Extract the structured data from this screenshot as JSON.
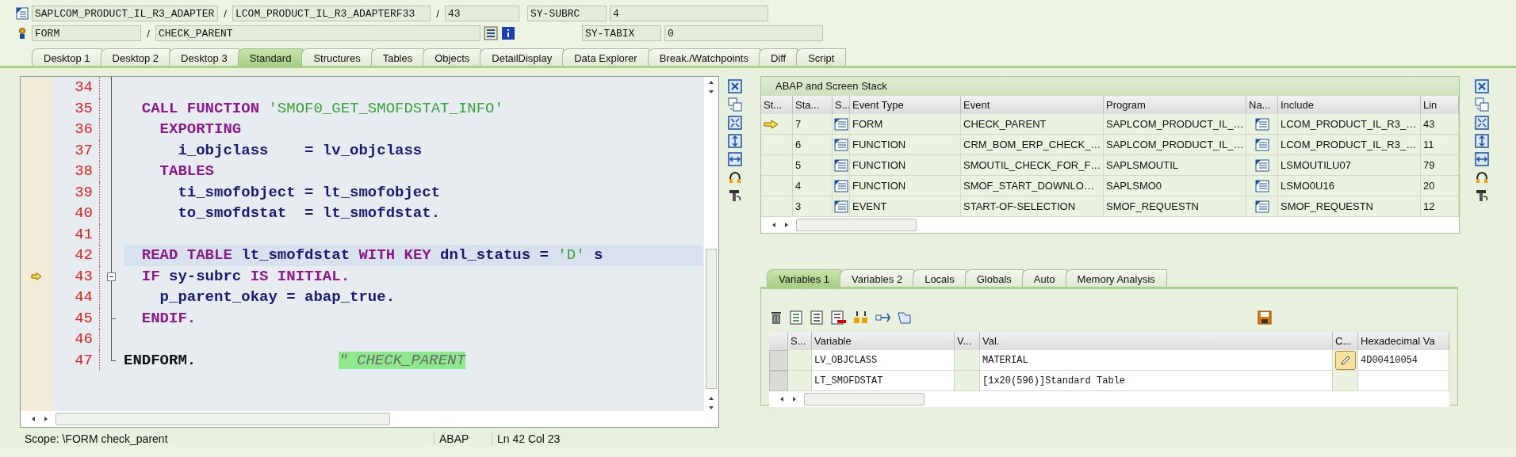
{
  "header": {
    "program": "SAPLCOM_PRODUCT_IL_R3_ADAPTER",
    "sep1": "/",
    "include": "LCOM_PRODUCT_IL_R3_ADAPTERF33",
    "sep2": "/",
    "line": "43",
    "subrc_label": "SY-SUBRC",
    "subrc_value": "4",
    "event_type": "FORM",
    "sep3": "/",
    "event": "CHECK_PARENT",
    "tabix_label": "SY-TABIX",
    "tabix_value": "0"
  },
  "tabs": [
    {
      "label": "Desktop 1",
      "selected": false
    },
    {
      "label": "Desktop 2",
      "selected": false
    },
    {
      "label": "Desktop 3",
      "selected": false
    },
    {
      "label": "Standard",
      "selected": true
    },
    {
      "label": "Structures",
      "selected": false
    },
    {
      "label": "Tables",
      "selected": false
    },
    {
      "label": "Objects",
      "selected": false
    },
    {
      "label": "DetailDisplay",
      "selected": false
    },
    {
      "label": "Data Explorer",
      "selected": false
    },
    {
      "label": "Break./Watchpoints",
      "selected": false
    },
    {
      "label": "Diff",
      "selected": false
    },
    {
      "label": "Script",
      "selected": false
    }
  ],
  "editor": {
    "lines": [
      {
        "number": "34",
        "current": false,
        "cursor_line": false,
        "collapsible": false,
        "block_end": false
      },
      {
        "number": "35",
        "current": false,
        "cursor_line": false,
        "collapsible": false,
        "block_end": false,
        "tokens": [
          {
            "text": "  CALL FUNCTION ",
            "kind": "keyword"
          },
          {
            "text": "'SMOF0_GET_SMOFDSTAT_INFO'",
            "kind": "string"
          }
        ]
      },
      {
        "number": "36",
        "current": false,
        "cursor_line": false,
        "collapsible": false,
        "block_end": false,
        "tokens": [
          {
            "text": "    EXPORTING",
            "kind": "keyword"
          }
        ]
      },
      {
        "number": "37",
        "current": false,
        "cursor_line": false,
        "collapsible": false,
        "block_end": false,
        "tokens": [
          {
            "text": "      i_objclass    = lv_objclass",
            "kind": "ident"
          }
        ]
      },
      {
        "number": "38",
        "current": false,
        "cursor_line": false,
        "collapsible": false,
        "block_end": false,
        "tokens": [
          {
            "text": "    TABLES",
            "kind": "keyword"
          }
        ]
      },
      {
        "number": "39",
        "current": false,
        "cursor_line": false,
        "collapsible": false,
        "block_end": false,
        "tokens": [
          {
            "text": "      ti_smofobject = lt_smofobject",
            "kind": "ident"
          }
        ]
      },
      {
        "number": "40",
        "current": false,
        "cursor_line": false,
        "collapsible": false,
        "block_end": false,
        "tokens": [
          {
            "text": "      to_smofdstat  = lt_smofdstat.",
            "kind": "ident"
          }
        ]
      },
      {
        "number": "41",
        "current": false,
        "cursor_line": false,
        "collapsible": false,
        "block_end": false
      },
      {
        "number": "42",
        "current": false,
        "cursor_line": true,
        "collapsible": false,
        "block_end": false,
        "tokens": [
          {
            "text": "  READ TABLE ",
            "kind": "keyword"
          },
          {
            "text": "lt_smofdstat ",
            "kind": "ident"
          },
          {
            "text": "WITH KEY ",
            "kind": "keyword"
          },
          {
            "text": "dnl_status = ",
            "kind": "ident"
          },
          {
            "text": "'D' ",
            "kind": "string"
          },
          {
            "text": "s",
            "kind": "ident"
          }
        ]
      },
      {
        "number": "43",
        "current": true,
        "cursor_line": false,
        "collapsible": true,
        "block_end": false,
        "tokens": [
          {
            "text": "  IF ",
            "kind": "keyword"
          },
          {
            "text": "sy-subrc ",
            "kind": "ident"
          },
          {
            "text": "IS INITIAL.",
            "kind": "keyword"
          }
        ]
      },
      {
        "number": "44",
        "current": false,
        "cursor_line": false,
        "collapsible": false,
        "block_end": false,
        "tokens": [
          {
            "text": "    p_parent_okay = abap_true.",
            "kind": "ident"
          }
        ]
      },
      {
        "number": "45",
        "current": false,
        "cursor_line": false,
        "collapsible": false,
        "block_end": true,
        "tokens": [
          {
            "text": "  ENDIF.",
            "kind": "keyword"
          }
        ]
      },
      {
        "number": "46",
        "current": false,
        "cursor_line": false,
        "collapsible": false,
        "block_end": false
      },
      {
        "number": "47",
        "current": false,
        "cursor_line": false,
        "collapsible": false,
        "block_end": true,
        "tokens": [
          {
            "text": "ENDFORM.",
            "kind": "plain"
          },
          {
            "text": "\" CHECK_PARENT",
            "kind": "comment"
          }
        ]
      }
    ]
  },
  "status_bar": {
    "scope": "Scope: \\FORM check_parent",
    "language": "ABAP",
    "position": "Ln  42 Col  23"
  },
  "stack": {
    "title": "ABAP and Screen Stack",
    "columns": [
      "St...",
      "Sta...",
      "S...",
      "Event Type",
      "Event",
      "Program",
      "Na...",
      "Include",
      "Lin"
    ],
    "rows": [
      {
        "current": true,
        "level": "7",
        "event_type": "FORM",
        "event": "CHECK_PARENT",
        "program": "SAPLCOM_PRODUCT_IL_…",
        "include": "LCOM_PRODUCT_IL_R3_…",
        "line": "43"
      },
      {
        "current": false,
        "level": "6",
        "event_type": "FUNCTION",
        "event": "CRM_BOM_ERP_CHECK_…",
        "program": "SAPLCOM_PRODUCT_IL_…",
        "include": "LCOM_PRODUCT_IL_R3_…",
        "line": "11"
      },
      {
        "current": false,
        "level": "5",
        "event_type": "FUNCTION",
        "event": "SMOUTIL_CHECK_FOR_F…",
        "program": "SAPLSMOUTIL",
        "include": "LSMOUTILU07",
        "line": "79"
      },
      {
        "current": false,
        "level": "4",
        "event_type": "FUNCTION",
        "event": "SMOF_START_DOWNLO…",
        "program": "SAPLSMO0",
        "include": "LSMO0U16",
        "line": "20"
      },
      {
        "current": false,
        "level": "3",
        "event_type": "EVENT",
        "event": "START-OF-SELECTION",
        "program": "SMOF_REQUESTN",
        "include": "SMOF_REQUESTN",
        "line": "12"
      }
    ]
  },
  "variables": {
    "tabs": [
      {
        "label": "Variables 1",
        "selected": true
      },
      {
        "label": "Variables 2",
        "selected": false
      },
      {
        "label": "Locals",
        "selected": false
      },
      {
        "label": "Globals",
        "selected": false
      },
      {
        "label": "Auto",
        "selected": false
      },
      {
        "label": "Memory Analysis",
        "selected": false
      }
    ],
    "columns": [
      "S...",
      "Variable",
      "V...",
      "Val.",
      "C...",
      "Hexadecimal Va"
    ],
    "rows": [
      {
        "variable": "LV_OBJCLASS",
        "value": "MATERIAL",
        "editable": true,
        "hex": "4D00410054"
      },
      {
        "variable": "LT_SMOFDSTAT",
        "value": "[1x20(596)]Standard Table",
        "editable": false
      }
    ]
  }
}
